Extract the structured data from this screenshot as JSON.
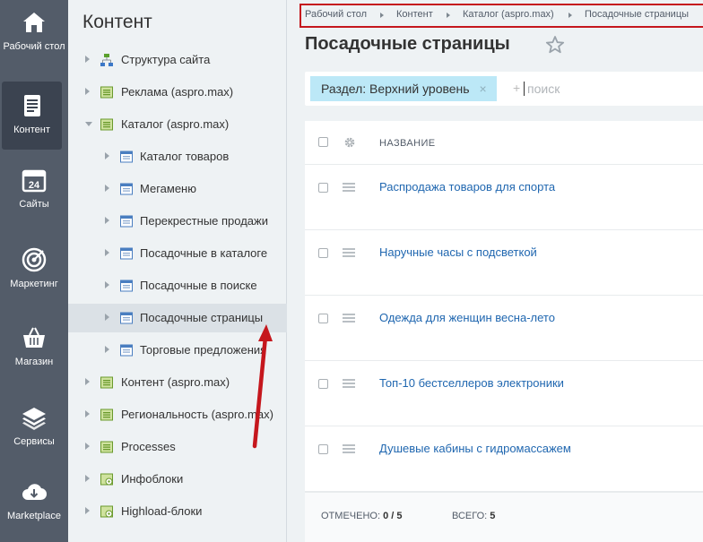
{
  "rail": {
    "items": [
      {
        "label": "Рабочий стол",
        "icon": "home-icon"
      },
      {
        "label": "Контент",
        "icon": "document-icon"
      },
      {
        "label": "Сайты",
        "icon": "calendar-24-icon"
      },
      {
        "label": "Маркетинг",
        "icon": "target-icon"
      },
      {
        "label": "Магазин",
        "icon": "basket-icon"
      },
      {
        "label": "Сервисы",
        "icon": "layers-icon"
      },
      {
        "label": "Marketplace",
        "icon": "cloud-download-icon"
      }
    ],
    "active": "Контент"
  },
  "tree": {
    "title": "Контент",
    "items": [
      {
        "label": "Структура сайта",
        "icon": "sitemap-icon"
      },
      {
        "label": "Реклама (aspro.max)",
        "icon": "iblock-type-icon"
      },
      {
        "label": "Каталог (aspro.max)",
        "icon": "iblock-type-icon",
        "expanded": true
      },
      {
        "label": "Каталог товаров",
        "icon": "iblock-icon"
      },
      {
        "label": "Мегаменю",
        "icon": "iblock-icon"
      },
      {
        "label": "Перекрестные продажи",
        "icon": "iblock-icon"
      },
      {
        "label": "Посадочные в каталоге",
        "icon": "iblock-icon"
      },
      {
        "label": "Посадочные в поиске",
        "icon": "iblock-icon"
      },
      {
        "label": "Посадочные страницы",
        "icon": "iblock-icon",
        "selected": true
      },
      {
        "label": "Торговые предложения",
        "icon": "iblock-icon"
      },
      {
        "label": "Контент (aspro.max)",
        "icon": "iblock-type-icon"
      },
      {
        "label": "Региональность (aspro.max)",
        "icon": "iblock-type-icon"
      },
      {
        "label": "Processes",
        "icon": "iblock-type-icon"
      },
      {
        "label": "Инфоблоки",
        "icon": "iblock-settings-icon"
      },
      {
        "label": "Highload-блоки",
        "icon": "iblock-settings-icon"
      }
    ]
  },
  "breadcrumb": {
    "items": [
      "Рабочий стол",
      "Контент",
      "Каталог (aspro.max)",
      "Посадочные страницы"
    ]
  },
  "page": {
    "title": "Посадочные страницы"
  },
  "search": {
    "chip": "Раздел: Верхний уровень",
    "chip_close": "×",
    "plus": "+",
    "placeholder": "поиск"
  },
  "grid": {
    "column_name": "НАЗВАНИЕ",
    "rows": [
      "Распродажа товаров для спорта",
      "Наручные часы с подсветкой",
      "Одежда для женщин весна-лето",
      "Топ-10 бестселлеров электроники",
      "Душевые кабины с гидромассажем"
    ],
    "footer": {
      "checked_label": "ОТМЕЧЕНО:",
      "checked_value": "0 / 5",
      "total_label": "ВСЕГО:",
      "total_value": "5"
    }
  },
  "colors": {
    "rail_bg": "#535c69",
    "link": "#2067b0",
    "chip_bg": "#bce8f7",
    "annotation_red": "#c5171d"
  }
}
